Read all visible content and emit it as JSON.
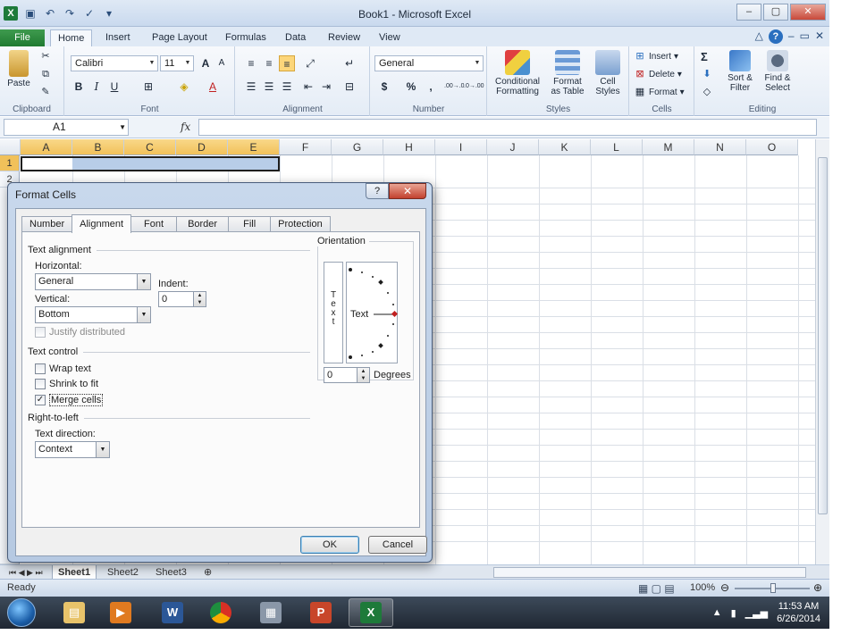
{
  "window": {
    "title": "Book1 - Microsoft Excel",
    "controls": [
      "–",
      "▢",
      "✕"
    ]
  },
  "ribbon_tabs": [
    "File",
    "Home",
    "Insert",
    "Page Layout",
    "Formulas",
    "Data",
    "Review",
    "View"
  ],
  "ribbon": {
    "clipboard": {
      "paste": "Paste",
      "label": "Clipboard"
    },
    "font": {
      "name": "Calibri",
      "size": "11",
      "bold": "B",
      "italic": "I",
      "underline": "U",
      "label": "Font"
    },
    "alignment": {
      "label": "Alignment"
    },
    "number": {
      "format": "General",
      "currency": "$",
      "percent": "%",
      "comma": ",",
      "inc_decimal": ".00→.0",
      "dec_decimal": ".0→.00",
      "label": "Number"
    },
    "styles": {
      "conditional_1": "Conditional",
      "conditional_2": "Formatting",
      "format_table_1": "Format",
      "format_table_2": "as Table",
      "cell_styles_1": "Cell",
      "cell_styles_2": "Styles",
      "label": "Styles"
    },
    "cells": {
      "insert": "Insert",
      "delete": "Delete",
      "format": "Format",
      "label": "Cells"
    },
    "editing": {
      "sum": "Σ",
      "sort_1": "Sort &",
      "sort_2": "Filter",
      "find_1": "Find &",
      "find_2": "Select",
      "label": "Editing"
    }
  },
  "formula_bar": {
    "name_box": "A1",
    "fx": "fx",
    "value": ""
  },
  "grid": {
    "columns": [
      "A",
      "B",
      "C",
      "D",
      "E",
      "F",
      "G",
      "H",
      "I",
      "J",
      "K",
      "L",
      "M",
      "N",
      "O"
    ],
    "rows": [
      "1",
      "2"
    ]
  },
  "sheets": [
    "Sheet1",
    "Sheet2",
    "Sheet3"
  ],
  "status": {
    "ready": "Ready",
    "zoom": "100%"
  },
  "taskbar": {
    "time": "11:53 AM",
    "date": "6/26/2014"
  },
  "dialog": {
    "title": "Format Cells",
    "help": "?",
    "close": "✕",
    "tabs": [
      "Number",
      "Alignment",
      "Font",
      "Border",
      "Fill",
      "Protection"
    ],
    "text_alignment": "Text alignment",
    "horizontal_label": "Horizontal:",
    "horizontal_value": "General",
    "indent_label": "Indent:",
    "indent_value": "0",
    "vertical_label": "Vertical:",
    "vertical_value": "Bottom",
    "justify_distributed": "Justify distributed",
    "text_control": "Text control",
    "wrap_text": "Wrap text",
    "shrink_to_fit": "Shrink to fit",
    "merge_cells": "Merge cells",
    "right_to_left": "Right-to-left",
    "text_direction_label": "Text direction:",
    "text_direction_value": "Context",
    "orientation": "Orientation",
    "orient_vertical": [
      "T",
      "e",
      "x",
      "t"
    ],
    "orient_text": "Text",
    "degrees_value": "0",
    "degrees_label": "Degrees",
    "ok": "OK",
    "cancel": "Cancel"
  }
}
